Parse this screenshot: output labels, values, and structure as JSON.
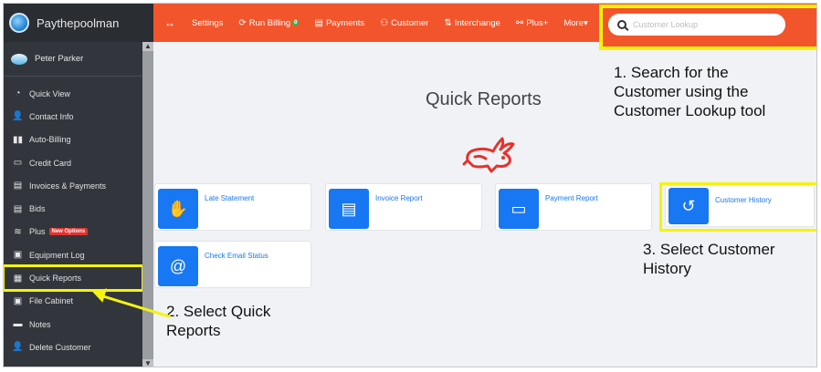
{
  "app": {
    "brand": "Paythepoolman",
    "user": "Peter Parker"
  },
  "sidebar": {
    "items": [
      {
        "label": "Quick View",
        "icon": "dashboard-icon"
      },
      {
        "label": "Contact Info",
        "icon": "contact-icon"
      },
      {
        "label": "Auto-Billing",
        "icon": "auto-billing-icon"
      },
      {
        "label": "Credit Card",
        "icon": "credit-card-icon"
      },
      {
        "label": "Invoices & Payments",
        "icon": "invoice-icon"
      },
      {
        "label": "Bids",
        "icon": "bids-icon"
      },
      {
        "label": "Plus",
        "icon": "plus-waves-icon",
        "badge": "New Options"
      },
      {
        "label": "Equipment Log",
        "icon": "clipboard-icon"
      },
      {
        "label": "Quick Reports",
        "icon": "report-icon",
        "active": true
      },
      {
        "label": "File Cabinet",
        "icon": "file-cabinet-icon"
      },
      {
        "label": "Notes",
        "icon": "notes-icon"
      },
      {
        "label": "Delete Customer",
        "icon": "delete-user-icon"
      }
    ]
  },
  "topbar": {
    "settings": "Settings",
    "run_billing": "Run Billing",
    "run_billing_badge": "0",
    "payments": "Payments",
    "customer": "Customer",
    "interchange": "Interchange",
    "plus": "Plus+",
    "more": "More"
  },
  "search": {
    "placeholder": "Customer Lookup"
  },
  "main": {
    "title": "Quick Reports",
    "cards": [
      {
        "label": "Late Statement",
        "icon": "hand-icon"
      },
      {
        "label": "Invoice Report",
        "icon": "document-icon"
      },
      {
        "label": "Payment Report",
        "icon": "check-icon"
      },
      {
        "label": "Customer History",
        "icon": "history-icon"
      },
      {
        "label": "Check Email Status",
        "icon": "at-sign-icon"
      }
    ]
  },
  "annotations": {
    "step1": [
      "1. Search for the",
      "Customer using the",
      "Customer Lookup tool"
    ],
    "step2": [
      "2. Select Quick",
      "Reports"
    ],
    "step3": [
      "3. Select Customer",
      "History"
    ]
  },
  "colors": {
    "accent": "#f2552c",
    "highlight": "#f4f40c",
    "card_icon": "#1877f2",
    "sidebar": "#32363c"
  }
}
